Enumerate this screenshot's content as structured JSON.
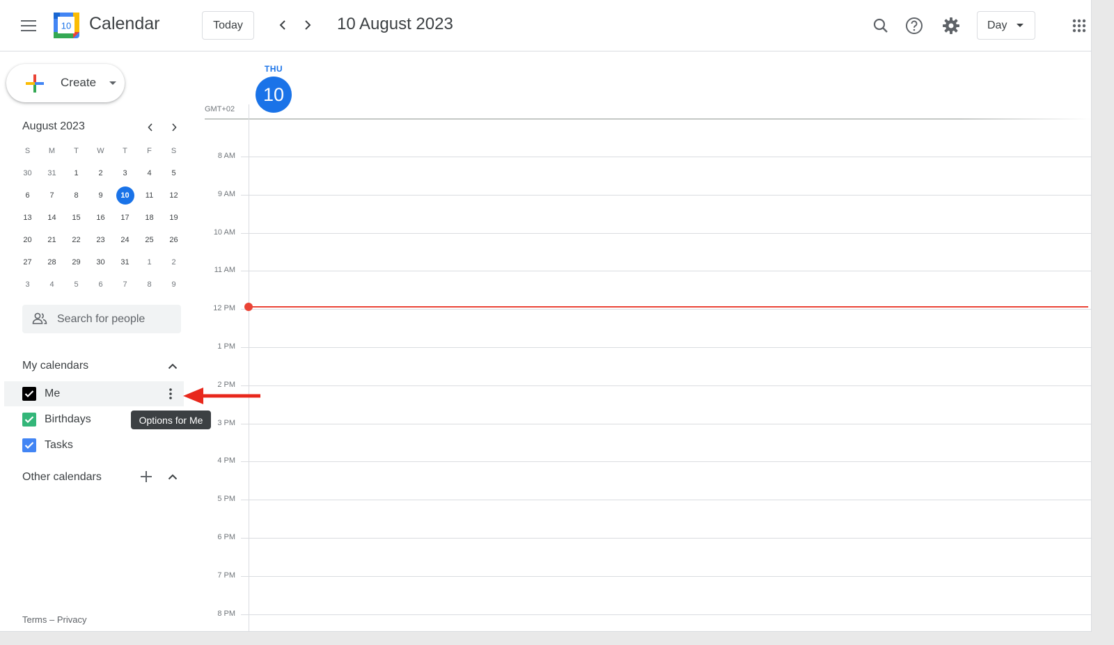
{
  "header": {
    "app_title": "Calendar",
    "logo_day": "10",
    "today_label": "Today",
    "current_date": "10 August 2023",
    "view_label": "Day"
  },
  "sidebar": {
    "create_label": "Create",
    "mini_calendar": {
      "title": "August 2023",
      "days_of_week": [
        "S",
        "M",
        "T",
        "W",
        "T",
        "F",
        "S"
      ],
      "weeks": [
        [
          "30",
          "31",
          "1",
          "2",
          "3",
          "4",
          "5"
        ],
        [
          "6",
          "7",
          "8",
          "9",
          "10",
          "11",
          "12"
        ],
        [
          "13",
          "14",
          "15",
          "16",
          "17",
          "18",
          "19"
        ],
        [
          "20",
          "21",
          "22",
          "23",
          "24",
          "25",
          "26"
        ],
        [
          "27",
          "28",
          "29",
          "30",
          "31",
          "1",
          "2"
        ],
        [
          "3",
          "4",
          "5",
          "6",
          "7",
          "8",
          "9"
        ]
      ],
      "selected": "10"
    },
    "search_people_placeholder": "Search for people",
    "my_calendars_label": "My calendars",
    "my_calendars": [
      {
        "name": "Me",
        "color": "#000000",
        "checked": true
      },
      {
        "name": "Birthdays",
        "color": "#33b679",
        "checked": true
      },
      {
        "name": "Tasks",
        "color": "#4285f4",
        "checked": true
      }
    ],
    "tooltip": "Options for Me",
    "other_calendars_label": "Other calendars",
    "footer": {
      "terms": "Terms",
      "separator": "–",
      "privacy": "Privacy"
    }
  },
  "day_view": {
    "day_of_week": "THU",
    "day_number": "10",
    "timezone": "GMT+02",
    "hours": [
      "8 AM",
      "9 AM",
      "10 AM",
      "11 AM",
      "12 PM",
      "1 PM",
      "2 PM",
      "3 PM",
      "4 PM",
      "5 PM",
      "6 PM",
      "7 PM",
      "8 PM"
    ]
  },
  "colors": {
    "accent": "#1a73e8",
    "now_indicator": "#ea4335",
    "annotation_arrow": "#e8281c"
  }
}
